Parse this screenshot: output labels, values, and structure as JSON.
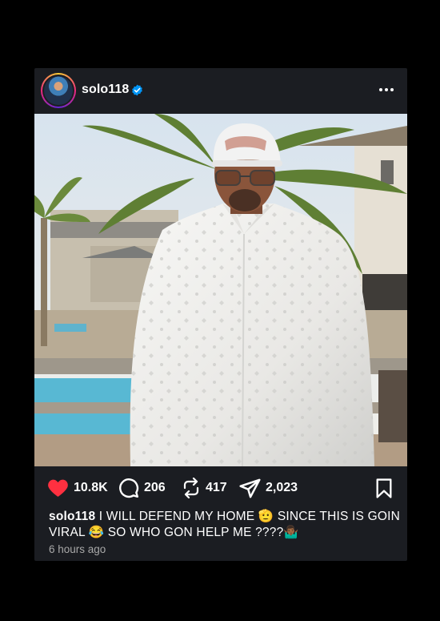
{
  "post": {
    "username": "solo118",
    "verified_icon": "verified-badge-icon",
    "menu_icon": "more-options-icon",
    "likes": "10.8K",
    "comments": "206",
    "reposts": "417",
    "shares": "2,023",
    "caption_user": "solo118",
    "caption_text": "I WILL DEFEND MY HOME 🫡 SINCE THIS IS GOIN VIRAL 😂 SO WHO GON HELP ME ????🤷🏾‍♂️",
    "timestamp": "6 hours ago"
  },
  "colors": {
    "background": "#000000",
    "card": "#1b1d22",
    "like": "#ff3040",
    "verified": "#0095f6",
    "muted_text": "#a8a8a8"
  }
}
